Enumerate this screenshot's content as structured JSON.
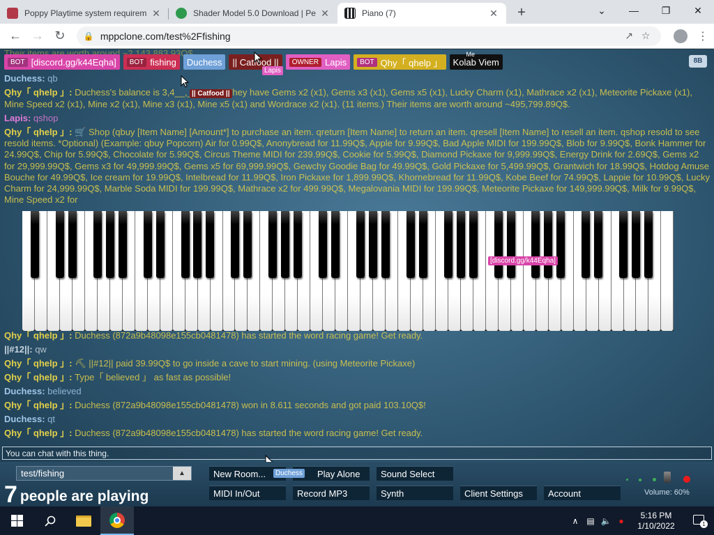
{
  "browser": {
    "tabs": [
      {
        "title": "Poppy Playtime system requirem",
        "favicon_color": "#b23a48",
        "active": false
      },
      {
        "title": "Shader Model 5.0 Download | Pe",
        "favicon_color": "#2e9a4e",
        "active": false
      },
      {
        "title": "Piano (7)",
        "favicon_color": "#202124",
        "active": true
      }
    ],
    "new_tab": "+",
    "url": "mppclone.com/test%2Ffishing",
    "win_minimize": "—",
    "win_restore": "❐",
    "win_close": "✕",
    "tab_list": "⌄"
  },
  "page": {
    "bb_button": "8B",
    "users": [
      {
        "tag": "BOT",
        "name": "[discord.gg/k44Eqha]",
        "color": "#d944a8"
      },
      {
        "tag": "BOT",
        "name": "fishing",
        "color": "#cc2e54"
      },
      {
        "tag": "",
        "name": "Duchess",
        "color": "#6fa0d8"
      },
      {
        "tag": "",
        "name": "|| Catfood ||",
        "color": "#7a1f1f"
      },
      {
        "tag": "OWNER",
        "name": "Lapis",
        "color": "#e15fc2"
      },
      {
        "tag": "BOT",
        "name": "Qhy「 qhelp 」",
        "color": "#d4b020"
      },
      {
        "tag": "",
        "name": "Kolab Viem",
        "color": "#111111"
      }
    ],
    "cursor_labels": {
      "lapis": "Lapis",
      "catfood": "|| Catfood ||",
      "discord": "[discord.gg/k44Eqha]",
      "me": "Me",
      "duchess": "Duchess"
    },
    "chat": [
      {
        "who": "",
        "text": "Their items are worth around ~2,143,883.93Q$.",
        "cls": "c-qhy",
        "dim": true
      },
      {
        "who": "Duchess:",
        "text": "qb",
        "cls": "c-duch",
        "dim": false
      },
      {
        "who": "Qhy「 qhelp 」:",
        "text": "Duchess's balance is 3,4__,__.31Q$. They have Gems x2 (x1), Gems x3 (x1), Gems x5 (x1), Lucky Charm (x1), Mathrace x2 (x1), Meteorite Pickaxe (x1), Mine Speed x2 (x1), Mine x2 (x1), Mine x3 (x1), Mine x5 (x1) and Wordrace x2 (x1). (11 items.) Their items are worth around ~495,799.89Q$.",
        "cls": "c-qhy",
        "dim": false
      },
      {
        "who": "Lapis:",
        "text": "qshop",
        "cls": "c-lapis",
        "dim": false
      },
      {
        "who": "Qhy「 qhelp 」:",
        "text": "🛒 Shop (qbuy [Item Name] [Amount*] to purchase an item. qreturn [Item Name] to return an item. qresell [Item Name] to resell an item. qshop resold to see resold items. *Optional) (Example: qbuy Popcorn) Air for 0.99Q$, Anonybread for 11.99Q$, Apple for 9.99Q$, Bad Apple MIDI for 199.99Q$, Blob for 9.99Q$, Bonk Hammer for 24.99Q$, Chip for 5.99Q$, Chocolate for 5.99Q$, Circus Theme MIDI for 239.99Q$, Cookie for 5.99Q$, Diamond Pickaxe for 9,999.99Q$, Energy Drink for 2.69Q$, Gems x2 for 29,999.99Q$, Gems x3 for 49,999.99Q$, Gems x5 for 69,999.99Q$, Gewchy Goodie Bag for 49.99Q$, Gold Pickaxe for 5,499.99Q$, Grantwich for 18.99Q$, Hotdog Amuse Bouche for 49.99Q$, Ice cream for 19.99Q$, Intelbread for 11.99Q$, Iron Pickaxe for 1,899.99Q$, Khornebread for 11.99Q$, Kobe Beef for 74.99Q$, Lappie for 10.99Q$, Lucky Charm for 24,999.99Q$, Marble Soda MIDI for 199.99Q$, Mathrace x2 for 499.99Q$, Megalovania MIDI for 199.99Q$, Meteorite Pickaxe for 149,999.99Q$, Milk for 9.99Q$, Mine Speed x2 for",
        "cls": "c-qhy",
        "dim": false
      }
    ],
    "chat_lower": [
      {
        "who": "Qhy「 qhelp 」:",
        "text": "Duchess (872a9b48098e155cb0481478) has started the word racing game! Get ready.",
        "cls": "c-qhy"
      },
      {
        "who": "||#12||:",
        "text": "qw",
        "cls": "c-12"
      },
      {
        "who": "Qhy「 qhelp 」:",
        "text": "⛏ ||#12|| paid 39.99Q$ to go inside a cave to start mining. (using Meteorite Pickaxe)",
        "cls": "c-qhy"
      },
      {
        "who": "Qhy「 qhelp 」:",
        "text": "Type「 believed 」 as fast as possible!",
        "cls": "c-qhy"
      },
      {
        "who": "Duchess:",
        "text": "believed",
        "cls": "c-duch"
      },
      {
        "who": "Qhy「 qhelp 」:",
        "text": " Duchess (872a9b48098e155cb0481478) won in 8.611 seconds and got paid 103.10Q$!",
        "cls": "c-qhy"
      },
      {
        "who": "Duchess:",
        "text": "qt",
        "cls": "c-duch"
      },
      {
        "who": "Qhy「 qhelp 」:",
        "text": "Duchess (872a9b48098e155cb0481478) has started the word racing game! Get ready.",
        "cls": "c-qhy"
      }
    ],
    "chat_placeholder": "You can chat with this thing.",
    "room": "test/fishing",
    "player_count": "7",
    "player_text": "people are playing",
    "controls": {
      "new_room": "New Room...",
      "play_alone": "Play Alone",
      "sound_select": "Sound Select",
      "midi": "MIDI In/Out",
      "record": "Record MP3",
      "synth": "Synth",
      "client_settings": "Client Settings",
      "account": "Account"
    },
    "volume": "Volume: 60%"
  },
  "taskbar": {
    "time": "5:16 PM",
    "date": "1/10/2022"
  }
}
